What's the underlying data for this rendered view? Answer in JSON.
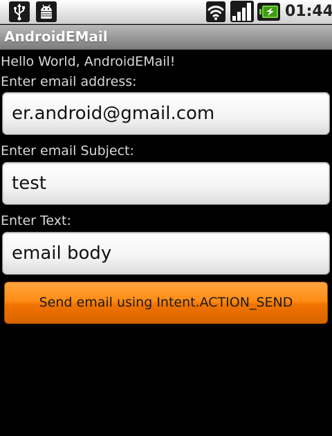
{
  "status_bar": {
    "time": "01:44",
    "icons": [
      "usb-icon",
      "android-debug-icon",
      "wifi-icon",
      "signal-icon",
      "battery-charging-icon"
    ]
  },
  "app": {
    "title": "AndroidEMail"
  },
  "content": {
    "greeting": "Hello World, AndroidEMail!",
    "address_label": "Enter email address:",
    "address_value": "er.android@gmail.com",
    "subject_label": "Enter email Subject:",
    "subject_value": "test",
    "text_label": "Enter Text:",
    "text_value": "email body",
    "send_label": "Send email using Intent.ACTION_SEND"
  },
  "colors": {
    "background": "#000000",
    "button_orange": "#ff8c14",
    "label_text": "#d9d9d9"
  }
}
